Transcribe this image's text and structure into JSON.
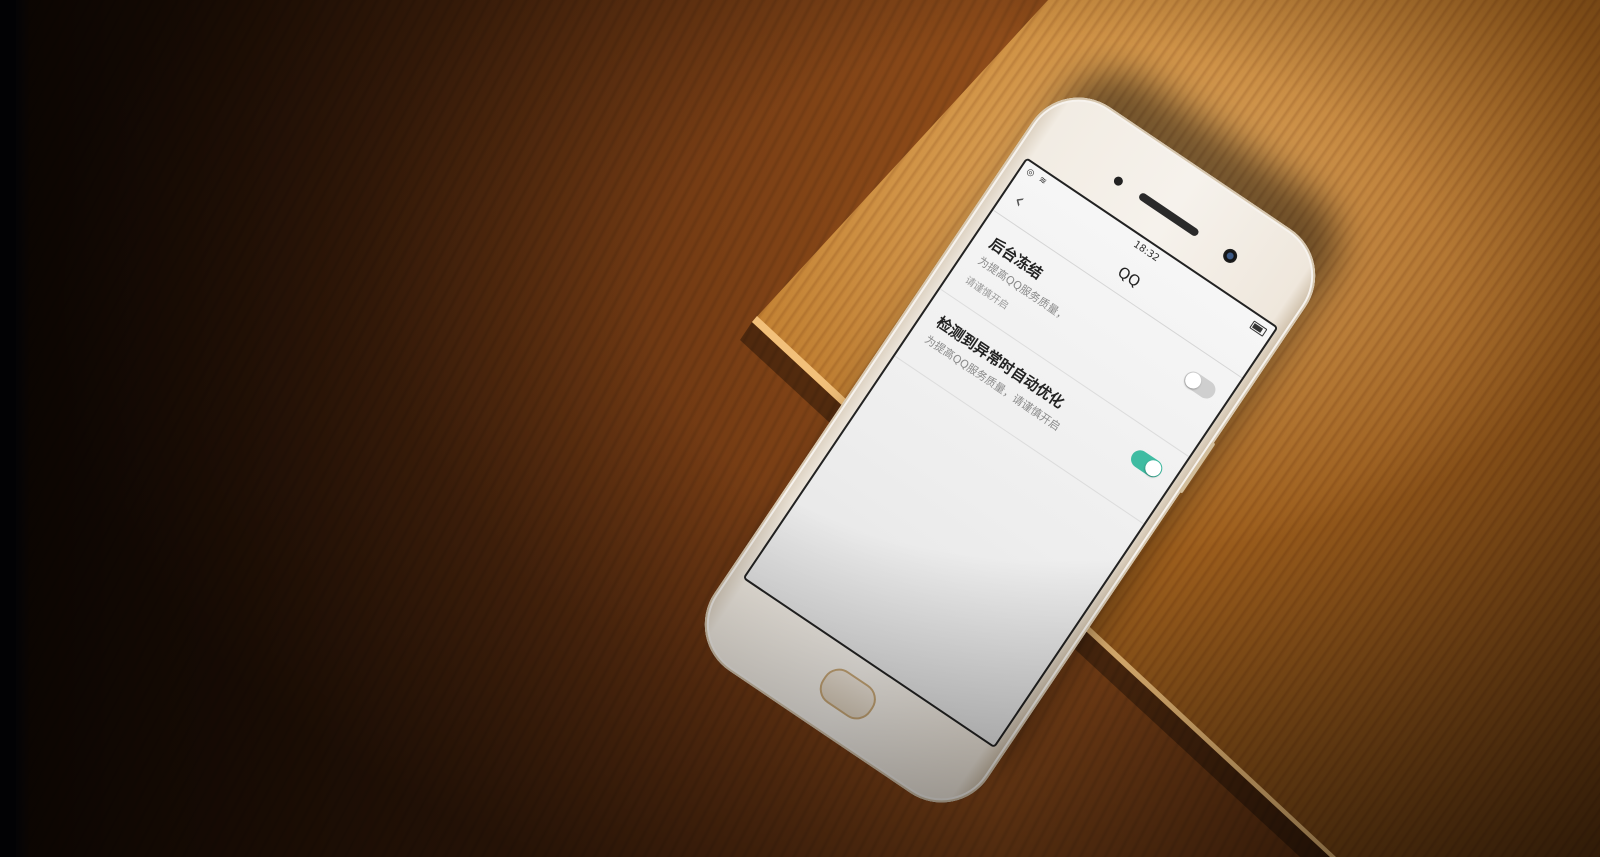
{
  "scene": {
    "colors": {
      "dark_wood": "#3a1c09",
      "light_wood": "#c98734",
      "accent_toggle": "#3fbca2"
    }
  },
  "phone": {
    "status_bar": {
      "time": "18:32",
      "icons": [
        "wifi-icon",
        "signal-icon",
        "battery-icon"
      ]
    },
    "nav": {
      "title": "QQ",
      "back_icon": "chevron-left-icon"
    },
    "settings": [
      {
        "title": "后台冻结",
        "subtitle": "为提高QQ服务质量，",
        "description": "请谨慎开启",
        "toggle": "off"
      },
      {
        "title": "检测到异常时自动优化",
        "subtitle": "为提高QQ服务质量，请谨慎开启",
        "description": "",
        "toggle": "on"
      }
    ]
  }
}
